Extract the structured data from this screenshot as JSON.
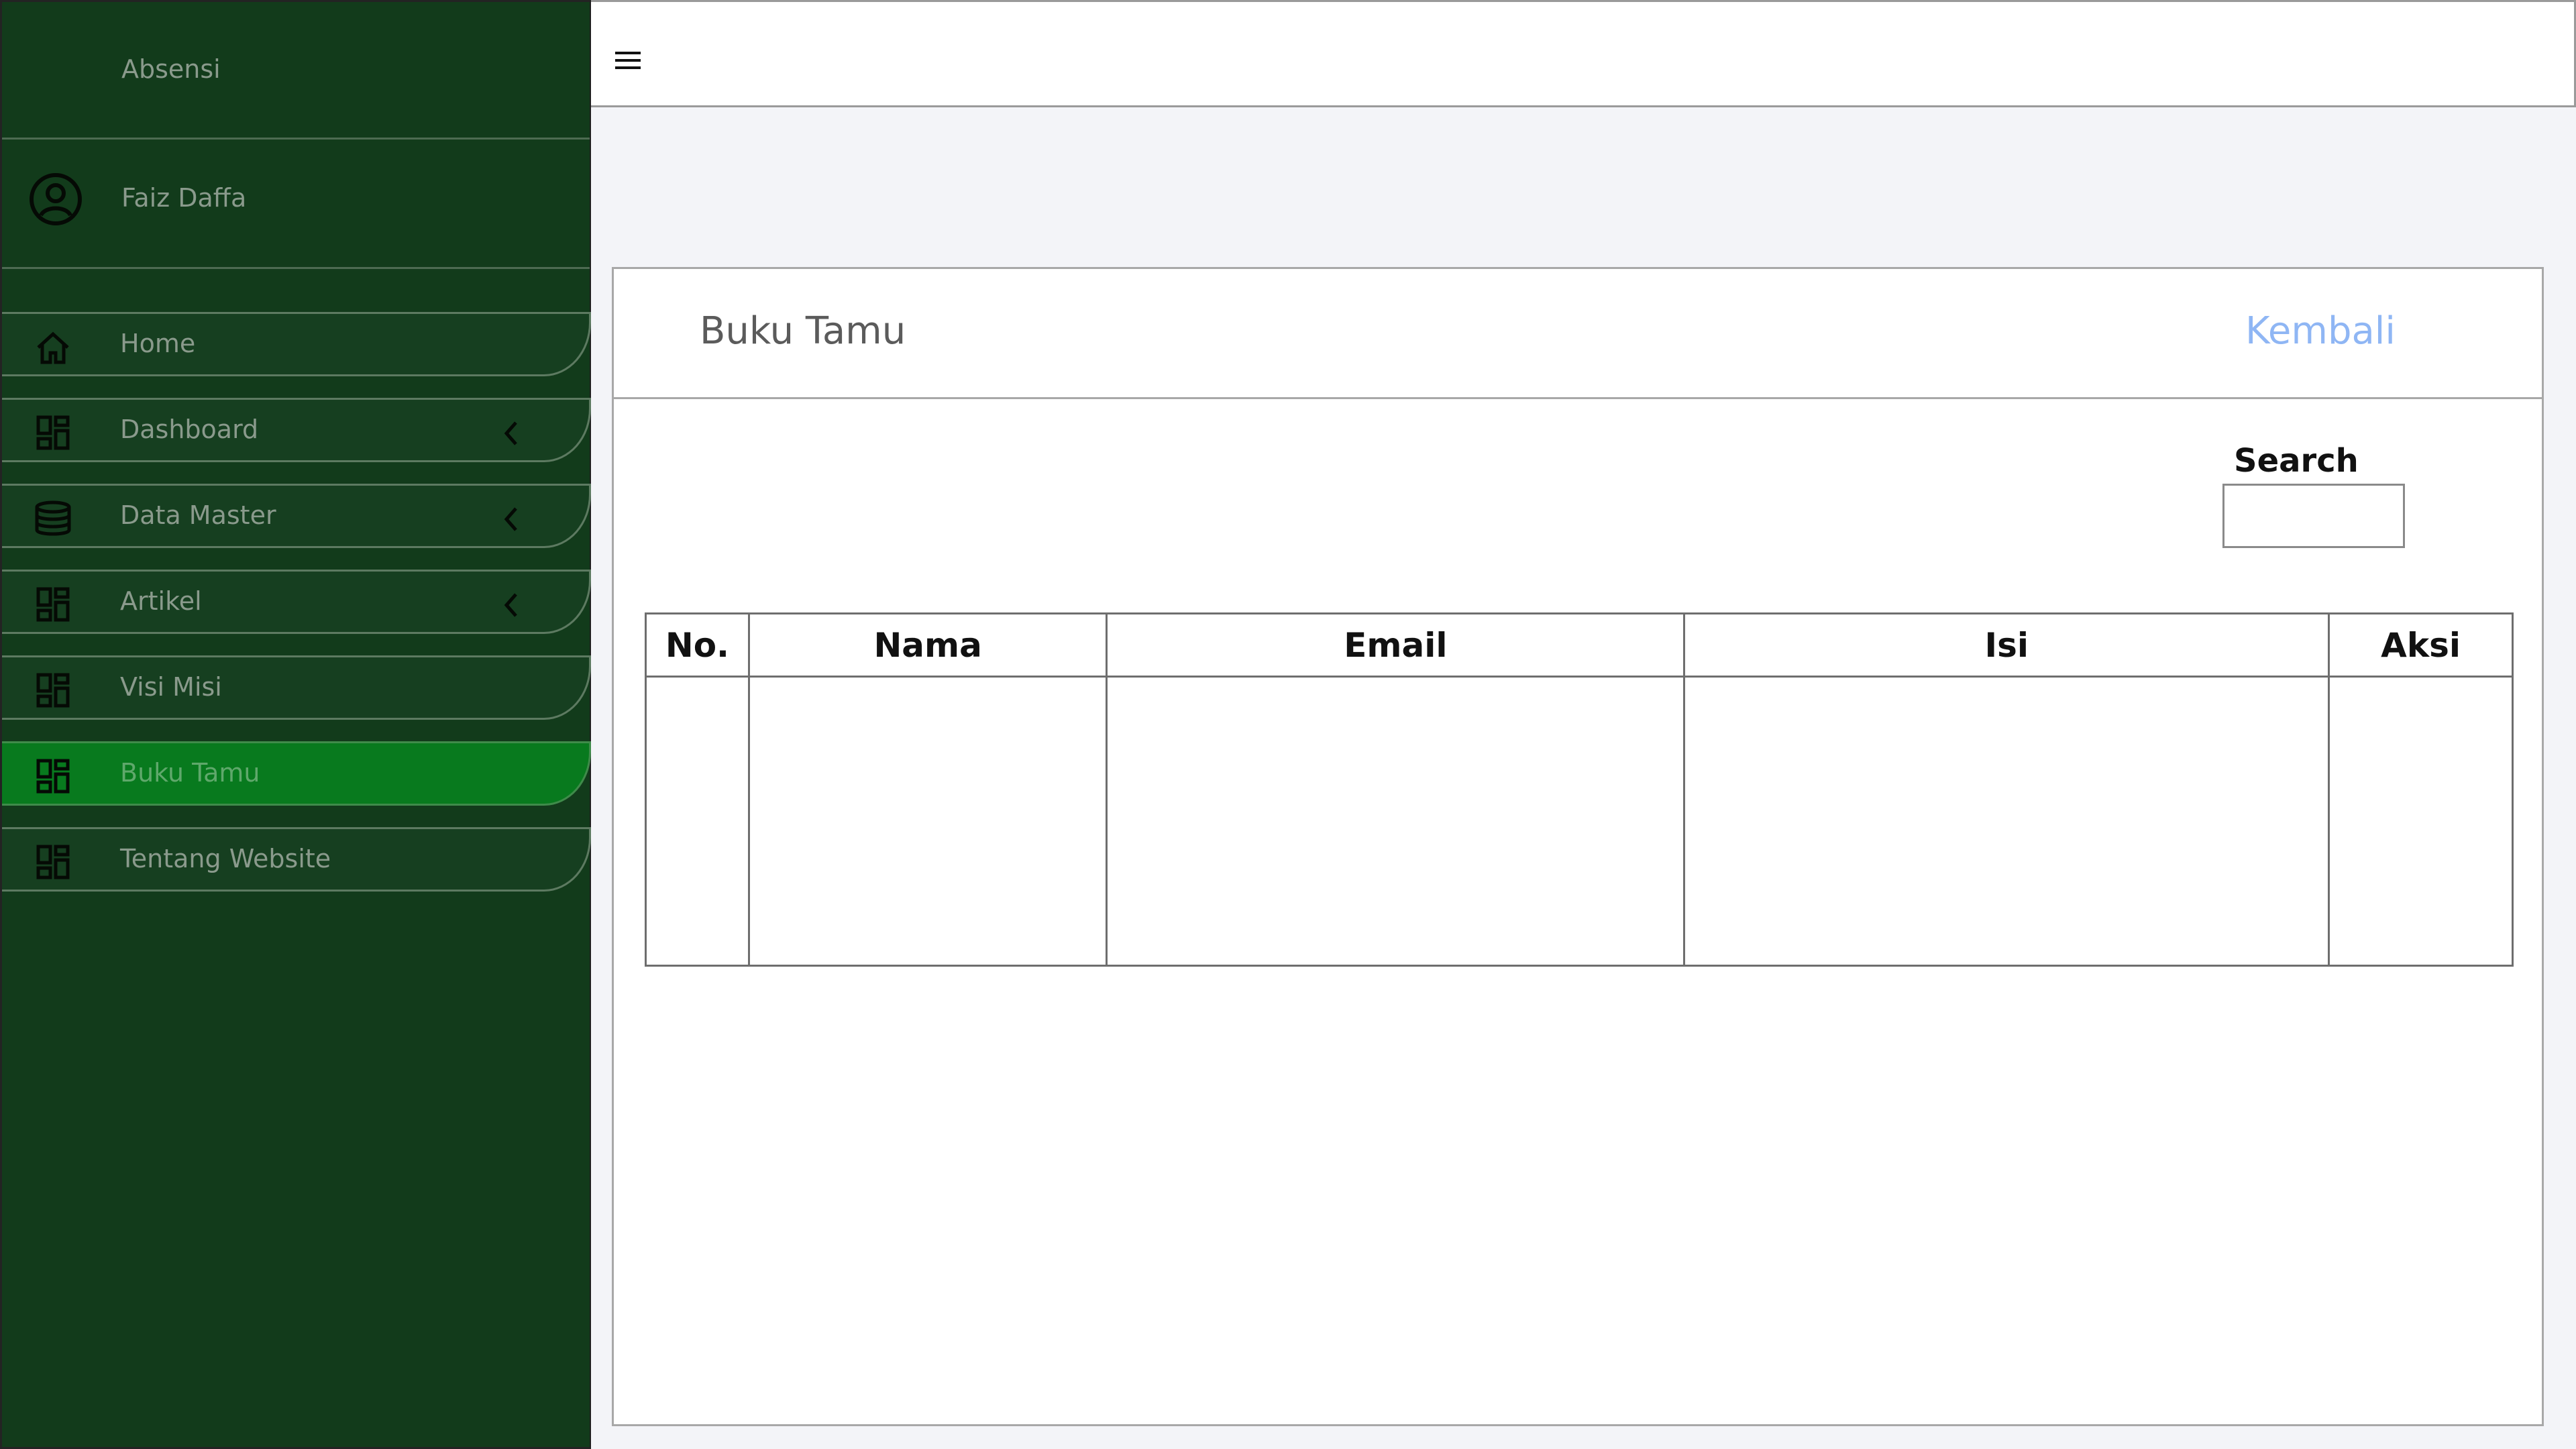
{
  "sidebar": {
    "brand": "Absensi",
    "user": {
      "name": "Faiz Daffa",
      "icon": "user-circle-icon"
    },
    "items": [
      {
        "label": "Home",
        "icon": "home-icon",
        "active": false,
        "has_chevron": false
      },
      {
        "label": "Dashboard",
        "icon": "dashboard-grid-icon",
        "active": false,
        "has_chevron": true
      },
      {
        "label": "Data Master",
        "icon": "database-icon",
        "active": false,
        "has_chevron": true
      },
      {
        "label": "Artikel",
        "icon": "dashboard-grid-icon",
        "active": false,
        "has_chevron": true
      },
      {
        "label": "Visi Misi",
        "icon": "dashboard-grid-icon",
        "active": false,
        "has_chevron": false
      },
      {
        "label": "Buku Tamu",
        "icon": "dashboard-grid-icon",
        "active": true,
        "has_chevron": false
      },
      {
        "label": "Tentang Website",
        "icon": "dashboard-grid-icon",
        "active": false,
        "has_chevron": false
      }
    ]
  },
  "topbar": {
    "menu_icon": "hamburger-icon"
  },
  "main": {
    "title": "Buku Tamu",
    "back_label": "Kembali",
    "search": {
      "label": "Search",
      "value": "",
      "placeholder": ""
    },
    "table": {
      "columns": [
        "No.",
        "Nama",
        "Email",
        "Isi",
        "Aksi"
      ],
      "rows": []
    }
  },
  "colors": {
    "sidebar_bg": "#123b1b",
    "active_item": "#087a1e",
    "link": "#8fb6f4",
    "page_bg": "#f3f4f8"
  }
}
